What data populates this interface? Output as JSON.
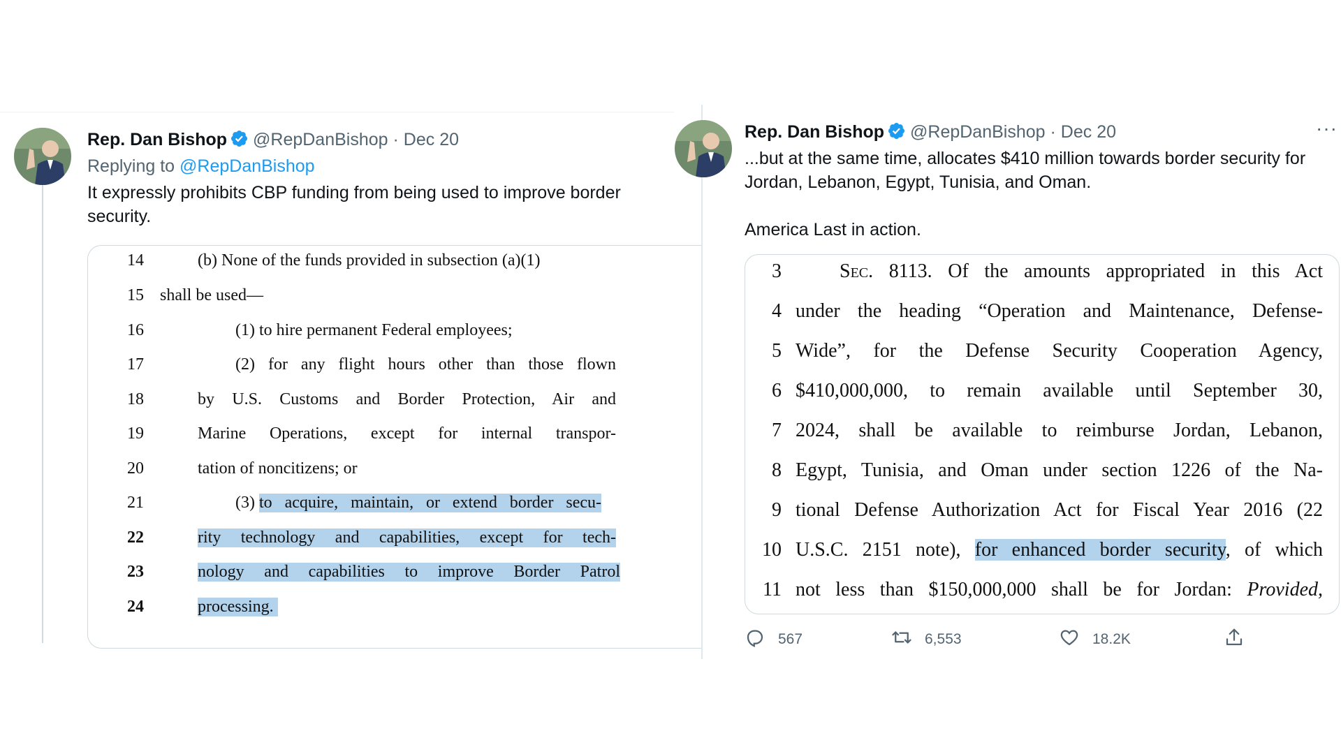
{
  "tweets": [
    {
      "author": "Rep. Dan Bishop",
      "handle": "@RepDanBishop",
      "separator": "·",
      "date": "Dec 20",
      "replying_prefix": "Replying to",
      "replying_to": "@RepDanBishop",
      "text": "It expressly prohibits CBP funding from being used to improve border security.",
      "bill_lines": [
        {
          "num": "14",
          "text": "(b) None of the funds provided in subsection (a)(1)"
        },
        {
          "num": "15",
          "text": "shall be used—"
        },
        {
          "num": "16",
          "text": "(1) to hire permanent Federal employees;"
        },
        {
          "num": "17",
          "text": "(2) for any flight hours other than those flown"
        },
        {
          "num": "18",
          "text": "by U.S. Customs and Border Protection, Air and"
        },
        {
          "num": "19",
          "text": "Marine Operations, except for internal transpor-"
        },
        {
          "num": "20",
          "text": "tation of noncitizens; or"
        },
        {
          "num": "21",
          "text_prefix": "(3) ",
          "text_highlight": "to acquire, maintain, or extend border secu-"
        },
        {
          "num": "22",
          "text_highlight": "rity technology and capabilities, except for tech-"
        },
        {
          "num": "23",
          "text_highlight": "nology and capabilities to improve Border Patrol"
        },
        {
          "num": "24",
          "text_highlight": "processing."
        }
      ]
    },
    {
      "author": "Rep. Dan Bishop",
      "handle": "@RepDanBishop",
      "separator": "·",
      "date": "Dec 20",
      "more": "···",
      "text_lines": [
        "...but at the same time, allocates $410 million towards border security for",
        "Jordan, Lebanon, Egypt, Tunisia, and Oman.",
        "America Last in action."
      ],
      "bill_lines": [
        {
          "num": "3",
          "text_sc": "Sec.",
          "text": " 8113. Of the amounts appropriated in this Act"
        },
        {
          "num": "4",
          "text": "under the heading “Operation and Maintenance, Defense-"
        },
        {
          "num": "5",
          "text": "Wide”, for the Defense Security Cooperation Agency,"
        },
        {
          "num": "6",
          "text": "$410,000,000, to remain available until September 30,"
        },
        {
          "num": "7",
          "text": "2024, shall be available to reimburse Jordan, Lebanon,"
        },
        {
          "num": "8",
          "text": "Egypt, Tunisia, and Oman under section 1226 of the Na-"
        },
        {
          "num": "9",
          "text": "tional Defense Authorization Act for Fiscal Year 2016 (22"
        },
        {
          "num": "10",
          "text": "U.S.C. 2151 note),",
          "text_highlight": "for enhanced border security",
          "text_after": ", of which"
        },
        {
          "num": "11",
          "text": "not less than $150,000,000 shall be for Jordan:",
          "text_italic": "Provided,"
        }
      ],
      "stats": {
        "replies": "567",
        "retweets": "6,553",
        "likes": "18.2K"
      },
      "icons": [
        "reply-icon",
        "retweet-icon",
        "like-icon",
        "share-icon"
      ]
    }
  ],
  "colors": {
    "verified": "#1d9bf0",
    "highlight": "#b3d2ec",
    "muted": "#536471"
  }
}
